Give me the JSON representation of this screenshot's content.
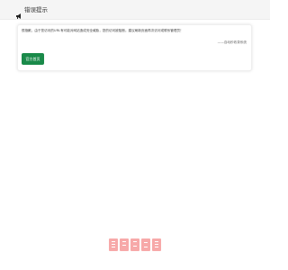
{
  "header": {
    "title": "错误提示",
    "icon": "megaphone-icon"
  },
  "card": {
    "message": "很抱歉，由于您访问的URL有可能对网站造成安全威胁，您的访问被阻断。建议刷新页面再次访问或联系管理员！",
    "signature": "——自动秒收录系统",
    "button_label": "官方首页"
  },
  "watermark": {
    "text": "自动秒收录",
    "color": "#f7a9a9"
  },
  "colors": {
    "header_bg": "#f5f5f5",
    "button_bg": "#1a8a4a",
    "watermark": "#f7a9a9"
  }
}
